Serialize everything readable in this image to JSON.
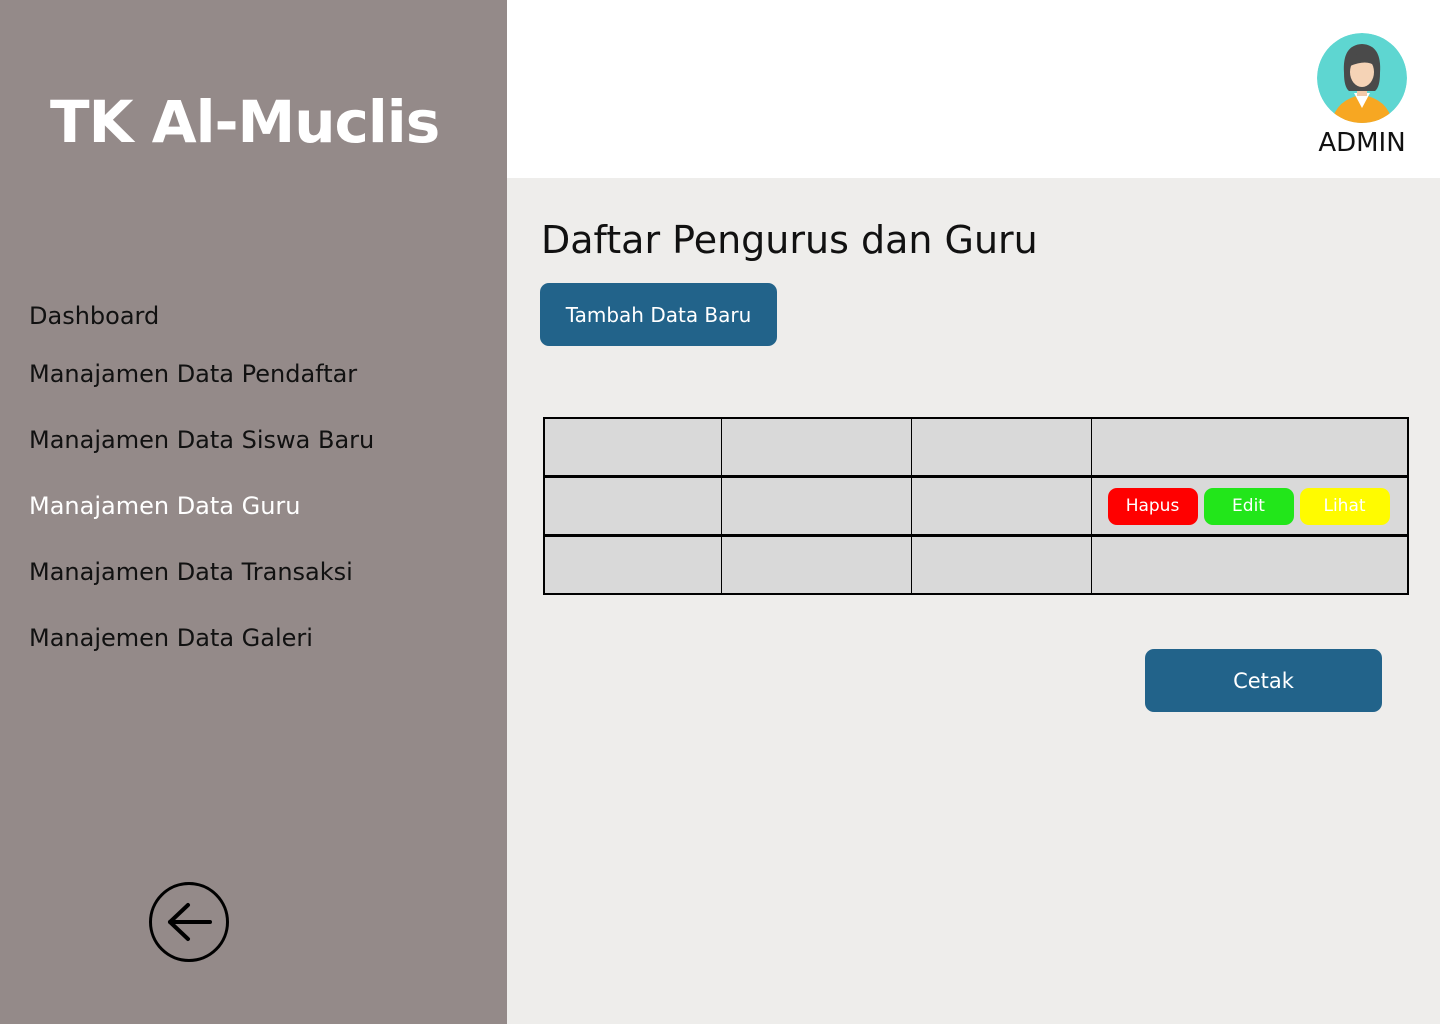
{
  "app": {
    "brand": "TK Al-Muclis"
  },
  "sidebar": {
    "items": [
      {
        "label": "Dashboard"
      },
      {
        "label": "Manajamen Data Pendaftar"
      },
      {
        "label": "Manajamen Data Siswa Baru"
      },
      {
        "label": "Manajamen Data Guru"
      },
      {
        "label": "Manajamen Data Transaksi"
      },
      {
        "label": "Manajemen Data Galeri"
      }
    ],
    "active_index": 3,
    "back_icon": "arrow-left-circle-icon"
  },
  "header": {
    "user_label": "ADMIN",
    "avatar_icon": "female-user-avatar-icon"
  },
  "main": {
    "title": "Daftar Pengurus dan Guru",
    "add_button": "Tambah Data Baru",
    "print_button": "Cetak",
    "row_actions": {
      "delete": "Hapus",
      "edit": "Edit",
      "view": "Lihat"
    }
  },
  "colors": {
    "sidebar_bg": "#948a89",
    "primary": "#22638a",
    "delete": "#ff0000",
    "edit": "#22e61a",
    "view": "#fffb00",
    "table_bg": "#d9d9d9",
    "content_bg": "#eeedeb"
  }
}
